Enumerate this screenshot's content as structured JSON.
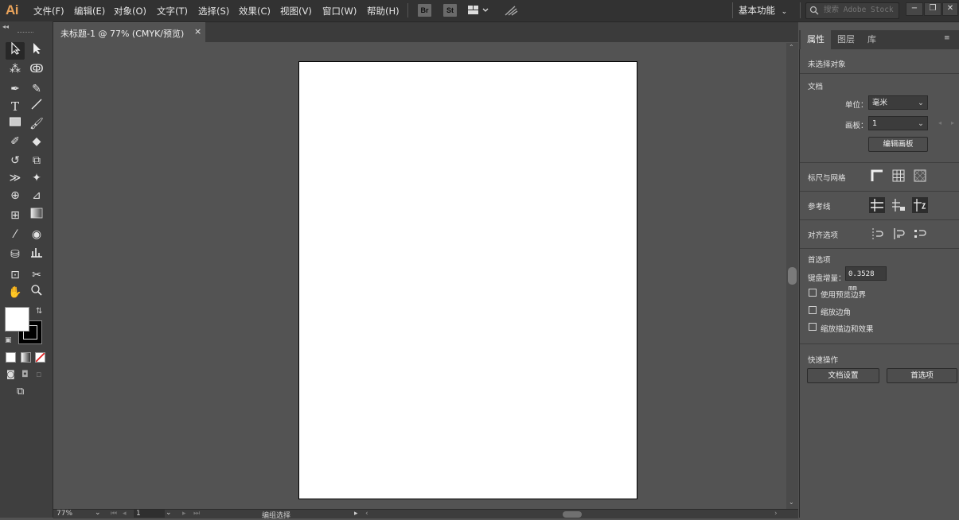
{
  "app": {
    "logo": "Ai"
  },
  "menu": [
    "文件(F)",
    "编辑(E)",
    "对象(O)",
    "文字(T)",
    "选择(S)",
    "效果(C)",
    "视图(V)",
    "窗口(W)",
    "帮助(H)"
  ],
  "bridge_buttons": [
    "Br",
    "St"
  ],
  "workspace": {
    "label": "基本功能"
  },
  "stock_search": {
    "placeholder": "搜索 Adobe Stock"
  },
  "document_tab": {
    "title": "未标题-1 @ 77% (CMYK/预览)",
    "close": "×"
  },
  "statusbar": {
    "zoom": "77%",
    "artboard_number": "1",
    "tool_status": "编组选择"
  },
  "panel": {
    "tabs": [
      "属性",
      "图层",
      "库"
    ],
    "active_tab": "属性",
    "no_selection": "未选择对象",
    "document_section": "文档",
    "units_label": "单位：",
    "units_value": "毫米",
    "artboard_label": "画板：",
    "artboard_value": "1",
    "edit_artboards_button": "编辑画板",
    "rulers_grids_section": "标尺与网格",
    "guides_section": "参考线",
    "snap_section": "对齐选项",
    "preferences_section": "首选项",
    "keyboard_increment_label": "键盘增量：",
    "keyboard_increment_value": "0.3528 mm",
    "checkboxes": [
      "使用预览边界",
      "缩放边角",
      "缩放描边和效果"
    ],
    "quick_actions_section": "快速操作",
    "document_setup_button": "文档设置",
    "preferences_button": "首选项"
  },
  "colors": {
    "accent_logo": "#e8a25a",
    "fill": "#ffffff",
    "stroke": "#000000",
    "canvas": "#535353",
    "ui_dark": "#323232"
  }
}
